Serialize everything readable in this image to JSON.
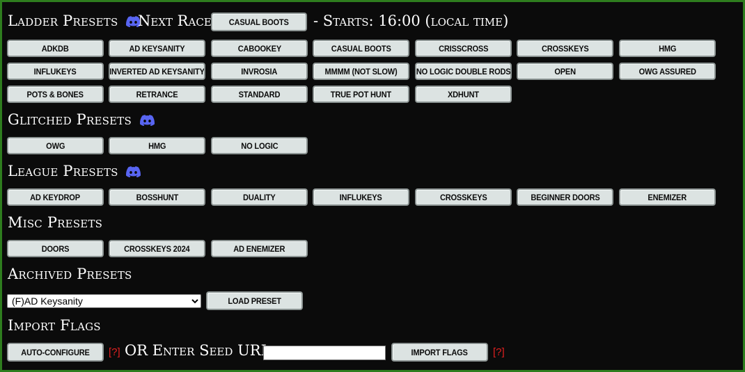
{
  "ladder": {
    "title": "Ladder Presets",
    "next_race_label": "Next Race:",
    "next_race_button": "Casual Boots",
    "starts_text": "- Starts: 16:00 (local time)",
    "buttons": [
      "ADKDB",
      "AD Keysanity",
      "Cabookey",
      "Casual Boots",
      "Crisscross",
      "Crosskeys",
      "HMG",
      "Influkeys",
      "Inverted AD Keysanity",
      "Invrosia",
      "MMMM (Not Slow)",
      "No Logic Double Rods",
      "Open",
      "OWG Assured",
      "Pots & Bones",
      "Retrance",
      "Standard",
      "True Pot Hunt",
      "XDHunt"
    ]
  },
  "glitched": {
    "title": "Glitched Presets",
    "buttons": [
      "OWG",
      "HMG",
      "No Logic"
    ]
  },
  "league": {
    "title": "League Presets",
    "buttons": [
      "AD Keydrop",
      "Bosshunt",
      "Duality",
      "Influkeys",
      "Crosskeys",
      "Beginner Doors",
      "Enemizer"
    ]
  },
  "misc": {
    "title": "Misc Presets",
    "buttons": [
      "Doors",
      "Crosskeys 2024",
      "AD Enemizer"
    ]
  },
  "archived": {
    "title": "Archived Presets",
    "selected": "(F)AD Keysanity",
    "load_label": "Load Preset"
  },
  "import": {
    "title": "Import Flags",
    "auto_label": "Auto-Configure",
    "help1": "[?]",
    "or_text": "OR Enter Seed URL:",
    "url_value": "",
    "import_label": "Import Flags",
    "help2": "[?]"
  },
  "colors": {
    "border": "#2e7d1e",
    "background": "#0b0b0b",
    "button": "#dce3e2",
    "help": "#e02020",
    "discord": "#5865f2"
  },
  "icons": {
    "discord": "discord-icon"
  }
}
